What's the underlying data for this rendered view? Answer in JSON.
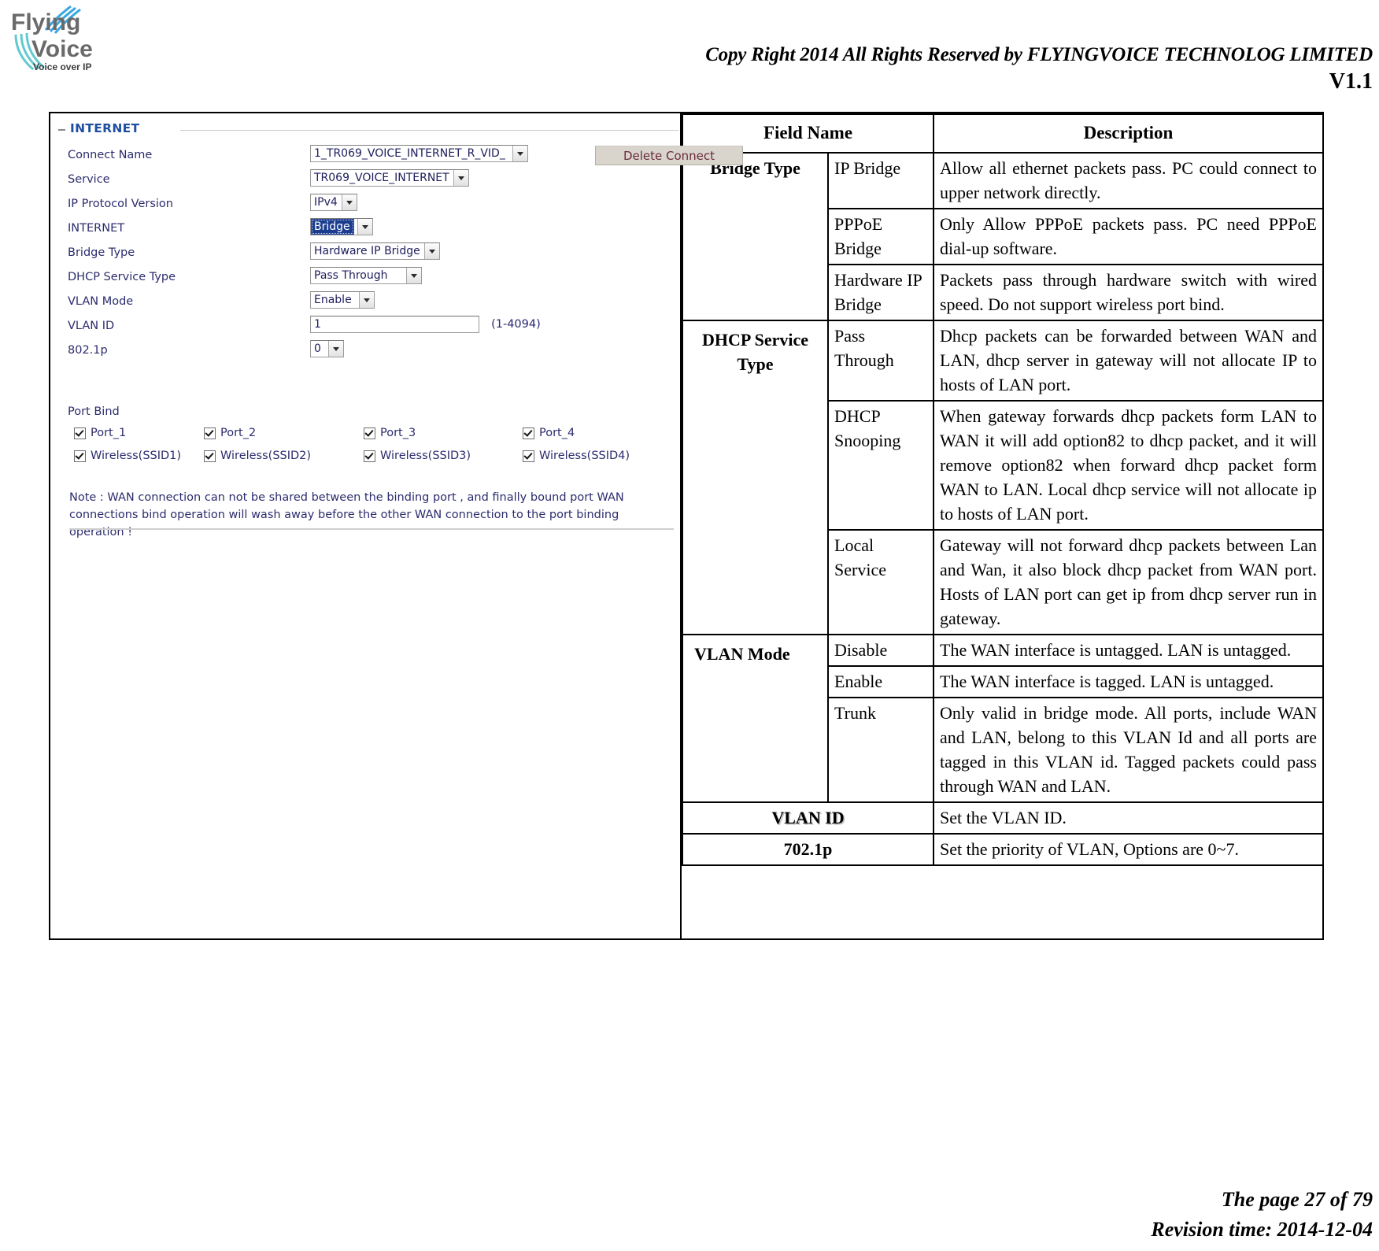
{
  "header": {
    "copyright": "Copy Right 2014 All Rights Reserved by FLYINGVOICE TECHNOLOG LIMITED",
    "version": "V1.1",
    "logo_line1": "Flying",
    "logo_line2": "Voice",
    "logo_tagline": "Voice over IP"
  },
  "router_panel": {
    "legend": "INTERNET",
    "delete_button": "Delete Connect",
    "fields": [
      {
        "label": "Connect Name",
        "value": "1_TR069_VOICE_INTERNET_R_VID_",
        "type": "select"
      },
      {
        "label": "Service",
        "value": "TR069_VOICE_INTERNET",
        "type": "select"
      },
      {
        "label": "IP Protocol Version",
        "value": "IPv4",
        "type": "select"
      },
      {
        "label": "INTERNET",
        "value": "Bridge",
        "type": "select"
      },
      {
        "label": "Bridge Type",
        "value": "Hardware IP Bridge",
        "type": "select"
      },
      {
        "label": "DHCP Service Type",
        "value": "Pass Through",
        "type": "select"
      },
      {
        "label": "VLAN Mode",
        "value": "Enable",
        "type": "select"
      },
      {
        "label": "VLAN ID",
        "value": "1",
        "hint": "(1-4094)",
        "type": "text"
      },
      {
        "label": "802.1p",
        "value": "0",
        "type": "select"
      }
    ],
    "port_bind": {
      "title": "Port Bind",
      "ports": [
        "Port_1",
        "Port_2",
        "Port_3",
        "Port_4"
      ],
      "ssids": [
        "Wireless(SSID1)",
        "Wireless(SSID2)",
        "Wireless(SSID3)",
        "Wireless(SSID4)"
      ]
    },
    "note": "Note : WAN connection can not be shared between the binding port , and finally bound port WAN connections bind operation will wash away before the other WAN connection to the port binding operation !"
  },
  "desc_table": {
    "headers": {
      "field": "Field Name",
      "description": "Description"
    },
    "groups": [
      {
        "field": "Bridge Type",
        "rows": [
          {
            "option": "IP Bridge",
            "desc": "Allow all ethernet packets pass. PC could connect to upper network directly."
          },
          {
            "option": "PPPoE Bridge",
            "desc": "Only Allow PPPoE packets pass. PC need PPPoE dial-up software."
          },
          {
            "option": "Hardware IP Bridge",
            "desc": "Packets pass through hardware switch with wired speed. Do not support wireless port bind."
          }
        ]
      },
      {
        "field": "DHCP Service Type",
        "rows": [
          {
            "option": "Pass Through",
            "desc": "Dhcp packets can be forwarded between WAN and LAN, dhcp server in gateway will not allocate IP to hosts of LAN port."
          },
          {
            "option": "DHCP Snooping",
            "desc": "When gateway forwards dhcp packets form LAN to WAN it will add option82 to dhcp packet, and it will remove option82 when forward dhcp packet form WAN to LAN. Local dhcp service will not allocate ip to hosts of LAN port."
          },
          {
            "option": "Local Service",
            "desc": "Gateway will not forward dhcp packets between Lan and Wan, it also block dhcp packet from WAN port. Hosts of LAN port can get ip from dhcp server run in gateway."
          }
        ]
      },
      {
        "field": "VLAN Mode",
        "rows": [
          {
            "option": "Disable",
            "desc": "The WAN interface is untagged. LAN is untagged."
          },
          {
            "option": "Enable",
            "desc": "The WAN interface is tagged. LAN is untagged."
          },
          {
            "option": "Trunk",
            "desc": "Only valid in bridge mode. All ports, include WAN and LAN, belong to this VLAN Id and all ports are tagged in this VLAN id. Tagged packets could pass through WAN and LAN."
          }
        ]
      }
    ],
    "simple_rows": [
      {
        "field": "VLAN ID",
        "desc": "Set the VLAN ID."
      },
      {
        "field": "702.1p",
        "desc": "Set the priority of VLAN, Options are 0~7."
      }
    ]
  },
  "footer": {
    "page": "The page 27 of 79",
    "revision": "Revision time: 2014-12-04"
  }
}
